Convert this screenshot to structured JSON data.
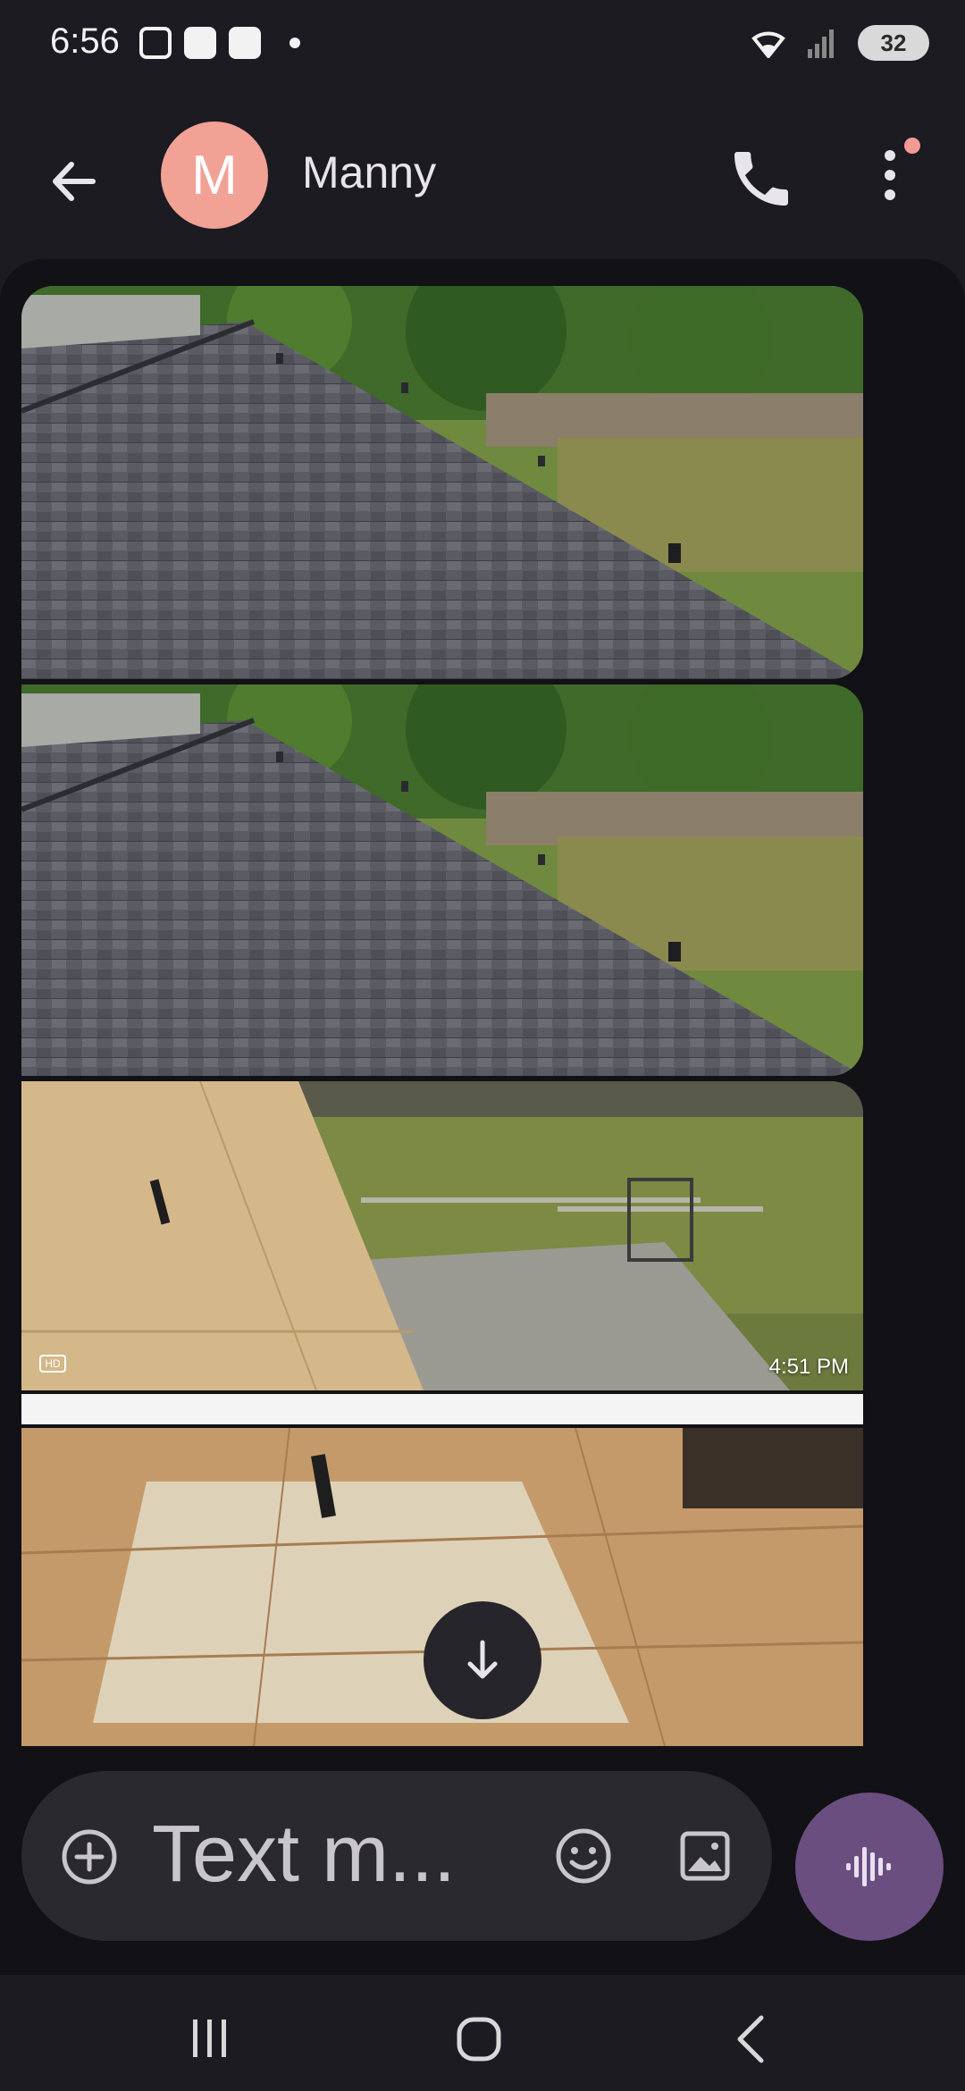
{
  "status_bar": {
    "time": "6:56",
    "battery": "32"
  },
  "header": {
    "avatar_letter": "M",
    "contact_name": "Manny",
    "avatar_color": "#f2a195"
  },
  "messages": {
    "photo_timestamp": "4:51 PM",
    "hd_badge": "HD"
  },
  "compose": {
    "placeholder": "Text m..."
  },
  "icons": {
    "back": "arrow-left-icon",
    "call": "phone-icon",
    "more": "more-vert-icon",
    "add": "add-circle-icon",
    "emoji": "emoji-icon",
    "gallery": "image-icon",
    "voice": "voice-waveform-icon",
    "scroll": "arrow-down-icon"
  },
  "colors": {
    "accent": "#6a4e80",
    "notification": "#f29b95"
  }
}
